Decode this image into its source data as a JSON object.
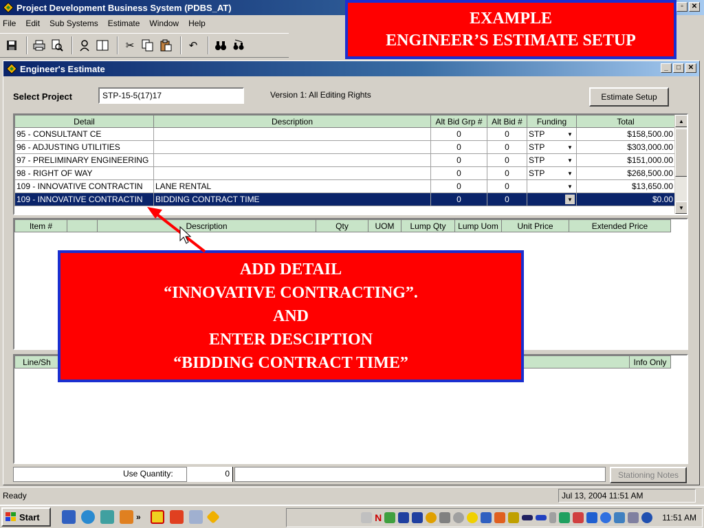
{
  "app": {
    "title": "Project Development Business System (PDBS_AT)"
  },
  "menu": [
    "File",
    "Edit",
    "Sub Systems",
    "Estimate",
    "Window",
    "Help"
  ],
  "callout_top": {
    "line1": "EXAMPLE",
    "line2": "ENGINEER’S ESTIMATE SETUP"
  },
  "child": {
    "title": "Engineer's Estimate",
    "select_project_label": "Select Project",
    "project_value": "STP-15-5(17)17",
    "version": "Version 1: All Editing Rights",
    "estimate_setup_label": "Estimate Setup"
  },
  "detail_grid": {
    "headers": [
      "Detail",
      "Description",
      "Alt Bid Grp #",
      "Alt Bid #",
      "Funding",
      "Total"
    ],
    "rows": [
      {
        "detail": "95 - CONSULTANT CE",
        "description": "",
        "alt_grp": "0",
        "alt_bid": "0",
        "funding": "STP",
        "total": "$158,500.00"
      },
      {
        "detail": "96 - ADJUSTING UTILITIES",
        "description": "",
        "alt_grp": "0",
        "alt_bid": "0",
        "funding": "STP",
        "total": "$303,000.00"
      },
      {
        "detail": "97 - PRELIMINARY ENGINEERING",
        "description": "",
        "alt_grp": "0",
        "alt_bid": "0",
        "funding": "STP",
        "total": "$151,000.00"
      },
      {
        "detail": "98 - RIGHT OF WAY",
        "description": "",
        "alt_grp": "0",
        "alt_bid": "0",
        "funding": "STP",
        "total": "$268,500.00"
      },
      {
        "detail": "109 - INNOVATIVE CONTRACTIN",
        "description": "LANE RENTAL",
        "alt_grp": "0",
        "alt_bid": "0",
        "funding": "",
        "total": "$13,650.00"
      },
      {
        "detail": "109 - INNOVATIVE CONTRACTIN",
        "description": "BIDDING CONTRACT TIME",
        "alt_grp": "0",
        "alt_bid": "0",
        "funding": "",
        "total": "$0.00"
      }
    ]
  },
  "item_grid": {
    "headers": [
      "Item #",
      "",
      "Description",
      "Qty",
      "UOM",
      "Lump Qty",
      "Lump Uom",
      "Unit Price",
      "Extended Price"
    ]
  },
  "line_grid": {
    "headers": [
      "Line/Sh",
      "Info Only"
    ]
  },
  "callout_mid": {
    "line1": "ADD DETAIL",
    "line2": "“INNOVATIVE CONTRACTING”.",
    "line3": "AND",
    "line4": "ENTER DESCIPTION",
    "line5": "“BIDDING CONTRACT TIME”"
  },
  "bottom": {
    "use_quantity_label": "Use Quantity:",
    "use_quantity_value": "0",
    "stationing_notes_label": "Stationing Notes"
  },
  "status": {
    "ready": "Ready",
    "datetime": "Jul 13, 2004 11:51 AM"
  },
  "taskbar": {
    "start_label": "Start",
    "clock": "11:51 AM"
  },
  "colors": {
    "callout_red": "#ff0000",
    "callout_border": "#1a2fd0",
    "grid_header": "#c8e4c8",
    "selection": "#0a246a"
  }
}
